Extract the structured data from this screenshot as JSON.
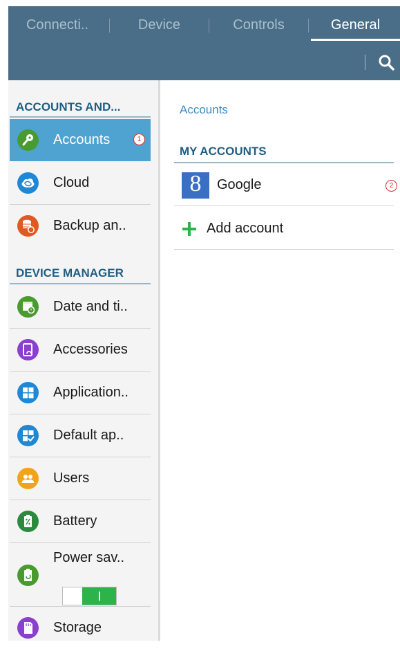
{
  "tabs": [
    {
      "label": "Connecti.."
    },
    {
      "label": "Device"
    },
    {
      "label": "Controls"
    },
    {
      "label": "General"
    }
  ],
  "active_tab": "General",
  "search_icon": "search-icon",
  "sidebar": {
    "section_accounts": "ACCOUNTS AND...",
    "section_device": "DEVICE MANAGER",
    "items": [
      {
        "label": "Accounts",
        "icon": "key-icon",
        "color": "#4a9b2f",
        "selected": true
      },
      {
        "label": "Cloud",
        "icon": "cloud-icon",
        "color": "#1e88d6"
      },
      {
        "label": "Backup an..",
        "icon": "backup-icon",
        "color": "#e05a1f"
      },
      {
        "label": "Date and ti..",
        "icon": "calendar-icon",
        "color": "#4a9b2f"
      },
      {
        "label": "Accessories",
        "icon": "accessories-icon",
        "color": "#8a3fd0"
      },
      {
        "label": "Application..",
        "icon": "apps-icon",
        "color": "#1e88d6"
      },
      {
        "label": "Default ap..",
        "icon": "default-apps-icon",
        "color": "#1e88d6"
      },
      {
        "label": "Users",
        "icon": "users-icon",
        "color": "#f0a41a"
      },
      {
        "label": "Battery",
        "icon": "battery-icon",
        "color": "#2b8a3e"
      },
      {
        "label": "Power sav..",
        "icon": "power-saving-icon",
        "color": "#4a9b2f",
        "toggle_on": true
      },
      {
        "label": "Storage",
        "icon": "storage-icon",
        "color": "#8a3fd0"
      }
    ]
  },
  "badges": {
    "one": "1",
    "two": "2"
  },
  "main": {
    "breadcrumb": "Accounts",
    "section_title": "MY ACCOUNTS",
    "accounts": [
      {
        "label": "Google",
        "logo_letter": "8"
      }
    ],
    "add_account": "Add account"
  }
}
